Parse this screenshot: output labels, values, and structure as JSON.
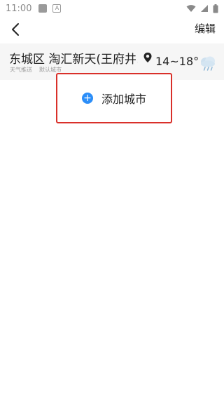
{
  "status_bar": {
    "time": "11:00",
    "icons": [
      "notification-icon",
      "app-icon",
      "wifi-icon",
      "signal-icon",
      "battery-icon"
    ]
  },
  "header": {
    "back_icon": "chevron-left-icon",
    "edit_label": "编辑"
  },
  "city_card": {
    "name": "东城区 淘汇新天(王府井…",
    "tags": [
      "天气推送",
      "默认城市"
    ],
    "location_icon": "location-pin-icon",
    "temperature": "14~18°",
    "weather_icon": "rain-cloud-icon"
  },
  "add_city": {
    "label": "添加城市",
    "icon": "plus-circle-icon",
    "accent_color": "#2c8ef8",
    "highlight_color": "#d9302a"
  }
}
